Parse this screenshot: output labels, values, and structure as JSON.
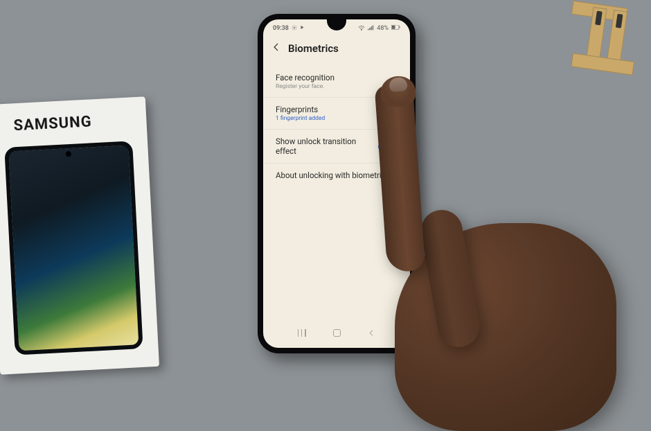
{
  "box": {
    "brand": "SAMSUNG"
  },
  "status": {
    "time": "09:38",
    "battery": "48%"
  },
  "header": {
    "title": "Biometrics"
  },
  "rows": {
    "face": {
      "title": "Face recognition",
      "subtitle": "Register your face."
    },
    "fingerprints": {
      "title": "Fingerprints",
      "subtitle": "1 fingerprint added"
    },
    "transition": {
      "title": "Show unlock transition effect"
    },
    "about": {
      "title": "About unlocking with biometrics"
    }
  }
}
